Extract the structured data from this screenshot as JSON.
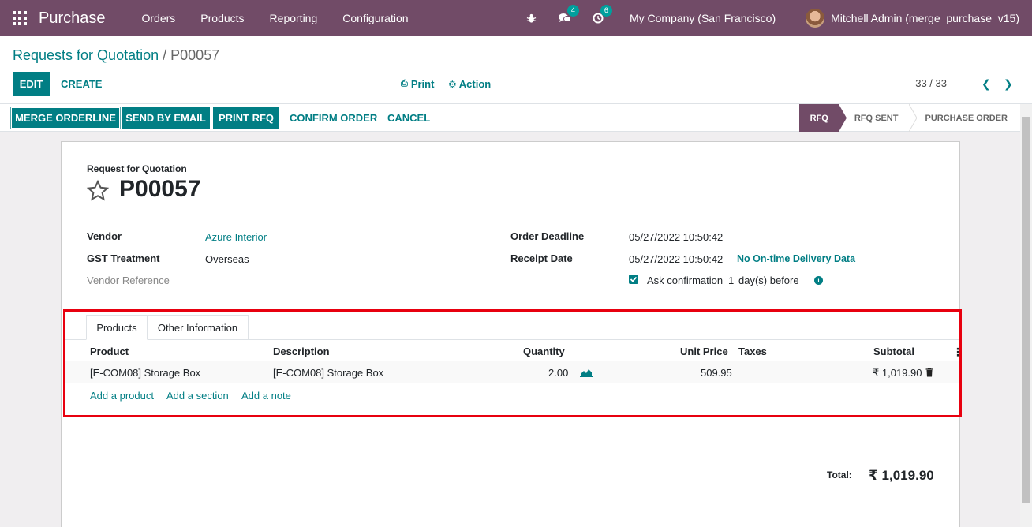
{
  "topbar": {
    "app_title": "Purchase",
    "menu": [
      "Orders",
      "Products",
      "Reporting",
      "Configuration"
    ],
    "chat_count": "4",
    "activity_count": "6",
    "company": "My Company (San Francisco)",
    "user": "Mitchell Admin (merge_purchase_v15)",
    "colors": {
      "bar": "#714b67",
      "accent": "#017e84",
      "highlight": "#e8000f"
    }
  },
  "breadcrumb": {
    "parent": "Requests for Quotation",
    "separator": "/",
    "current": "P00057"
  },
  "control": {
    "edit": "EDIT",
    "create": "CREATE",
    "print": "Print",
    "action": "Action",
    "pager": "33 / 33"
  },
  "actions": {
    "merge": "MERGE ORDERLINE",
    "send_email": "SEND BY EMAIL",
    "print_rfq": "PRINT RFQ",
    "confirm": "CONFIRM ORDER",
    "cancel": "CANCEL"
  },
  "status": {
    "steps": [
      "RFQ",
      "RFQ SENT",
      "PURCHASE ORDER"
    ],
    "active": "RFQ"
  },
  "form": {
    "doc_type": "Request for Quotation",
    "name": "P00057",
    "vendor_label": "Vendor",
    "vendor_value": "Azure Interior",
    "gst_label": "GST Treatment",
    "gst_value": "Overseas",
    "vendor_ref_label": "Vendor Reference",
    "deadline_label": "Order Deadline",
    "deadline_value": "05/27/2022 10:50:42",
    "receipt_label": "Receipt Date",
    "receipt_value": "05/27/2022 10:50:42",
    "delivery_note": "No On-time Delivery Data",
    "ask_confirm_label": "Ask confirmation",
    "ask_confirm_days": "1",
    "ask_confirm_suffix": "day(s) before"
  },
  "tabs": {
    "products": "Products",
    "other": "Other Information"
  },
  "table": {
    "headers": {
      "product": "Product",
      "description": "Description",
      "quantity": "Quantity",
      "unit_price": "Unit Price",
      "taxes": "Taxes",
      "subtotal": "Subtotal"
    },
    "row": {
      "product": "[E-COM08] Storage Box",
      "description": "[E-COM08] Storage Box",
      "quantity": "2.00",
      "unit_price": "509.95",
      "taxes": "",
      "subtotal": "₹ 1,019.90"
    },
    "add_product": "Add a product",
    "add_section": "Add a section",
    "add_note": "Add a note"
  },
  "total": {
    "label": "Total:",
    "value": "₹ 1,019.90"
  }
}
